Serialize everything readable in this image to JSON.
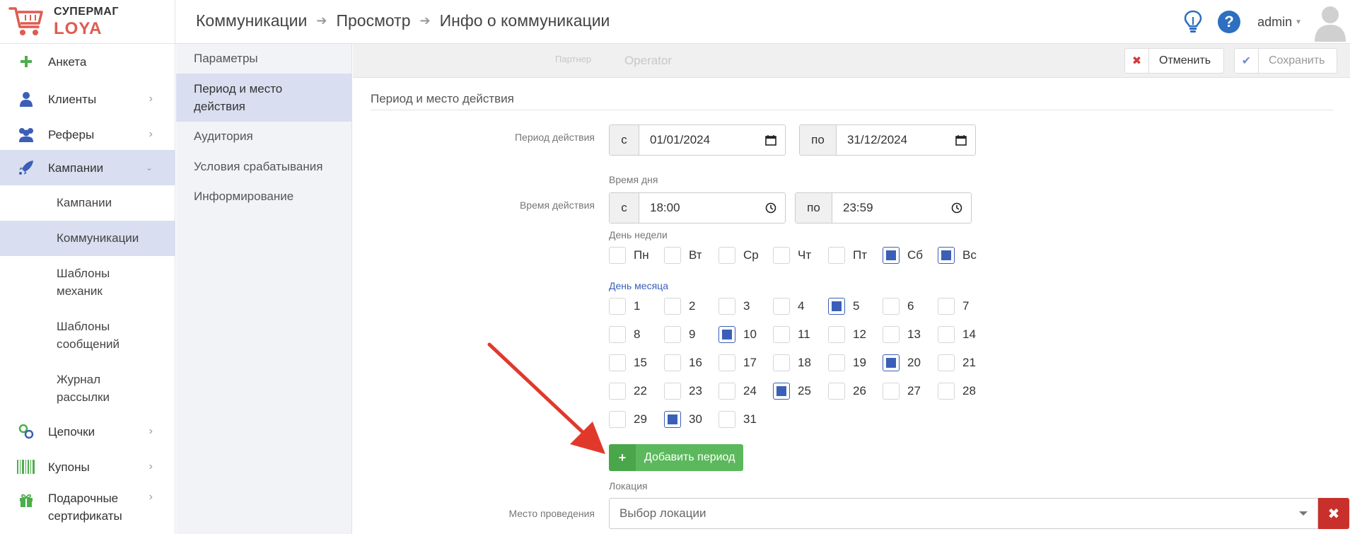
{
  "app": {
    "logo_top": "СУПЕРМАГ",
    "logo_bottom": "LOYA"
  },
  "breadcrumb": [
    "Коммуникации",
    "Просмотр",
    "Инфо о коммуникации"
  ],
  "header": {
    "user": "admin"
  },
  "nav": {
    "items": [
      {
        "label": "Анкета",
        "icon": "plus-icon"
      },
      {
        "label": "Клиенты",
        "icon": "user-icon"
      },
      {
        "label": "Реферы",
        "icon": "users-icon"
      },
      {
        "label": "Кампании",
        "icon": "rocket-icon"
      },
      {
        "label": "Цепочки",
        "icon": "link-icon"
      },
      {
        "label": "Купоны",
        "icon": "barcode-icon"
      },
      {
        "label": "Подарочные сертификаты",
        "icon": "gift-icon"
      }
    ],
    "sub_items": [
      "Кампании",
      "Коммуникации",
      "Шаблоны механик",
      "Шаблоны сообщений",
      "Журнал рассылки"
    ]
  },
  "subnav": [
    "Параметры",
    "Период и место действия",
    "Аудитория",
    "Условия срабатывания",
    "Информирование"
  ],
  "toolbar": {
    "faded_label": "Партнер",
    "faded_value": "Operator",
    "cancel_label": "Отменить",
    "save_label": "Сохранить"
  },
  "section": {
    "title": "Период и место действия",
    "period_label": "Период действия",
    "from_prefix": "с",
    "to_prefix": "по",
    "date_from": "01/01/2024",
    "date_to": "31/12/2024",
    "time_of_day_label": "Время дня",
    "time_label": "Время действия",
    "time_from": "18:00",
    "time_to": "23:59",
    "weekday_label": "День недели",
    "monthday_label": "День месяца",
    "add_period_label": "Добавить период",
    "location_small_label": "Локация",
    "location_label": "Место проведения",
    "location_placeholder": "Выбор локации"
  },
  "weekdays": [
    {
      "label": "Пн",
      "checked": false
    },
    {
      "label": "Вт",
      "checked": false
    },
    {
      "label": "Ср",
      "checked": false
    },
    {
      "label": "Чт",
      "checked": false
    },
    {
      "label": "Пт",
      "checked": false
    },
    {
      "label": "Сб",
      "checked": true
    },
    {
      "label": "Вс",
      "checked": true
    }
  ],
  "month_days_checked": [
    5,
    10,
    20,
    25,
    30
  ],
  "month_days_count": 31,
  "colors": {
    "accent": "#3b5fb8",
    "active_bg": "#d9dff0",
    "green": "#5cb85c",
    "danger": "#c9302c",
    "annotation_arrow": "#e0392c"
  }
}
